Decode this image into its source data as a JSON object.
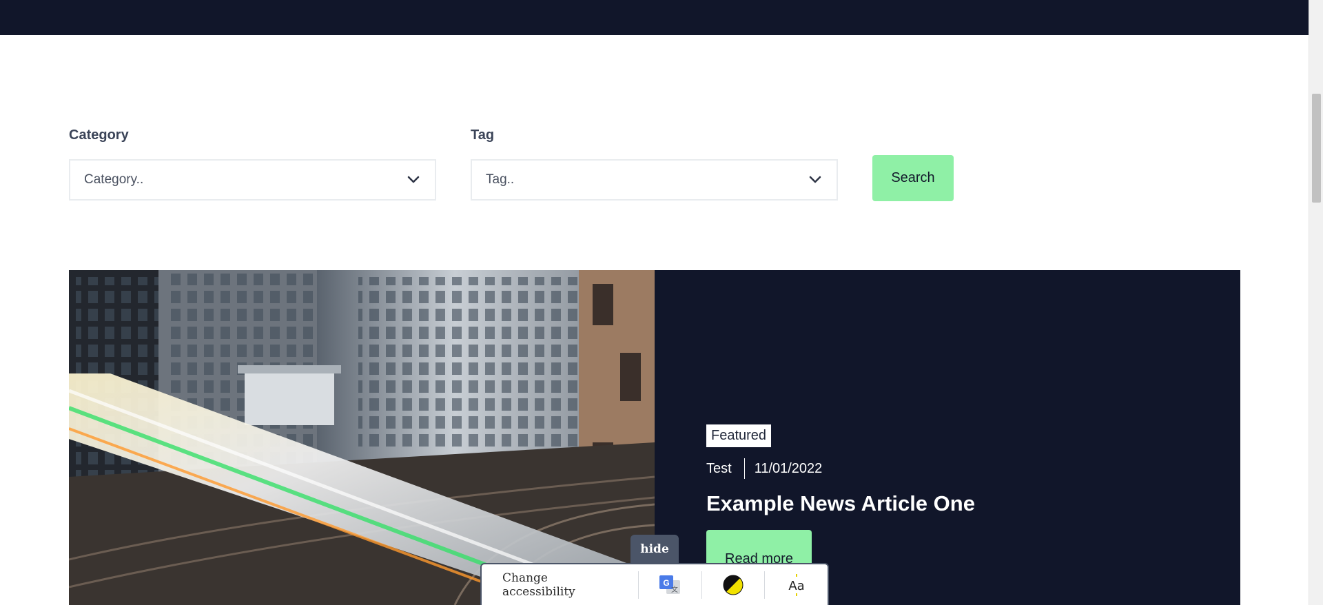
{
  "filters": {
    "category": {
      "label": "Category",
      "placeholder": "Category.."
    },
    "tag": {
      "label": "Tag",
      "placeholder": "Tag.."
    },
    "search_label": "Search"
  },
  "featured_article": {
    "badge": "Featured",
    "category": "Test",
    "date": "11/01/2022",
    "title": "Example News Article One",
    "read_more_label": "Read more",
    "image_icon": "train-city-photo"
  },
  "accessibility_bar": {
    "hide_label": "hide",
    "change_label": "Change accessibility",
    "buttons": [
      "google-translate-icon",
      "contrast-icon",
      "font-size-icon"
    ]
  },
  "colors": {
    "navy": "#11162a",
    "accent_green": "#8ff0a6",
    "label_gray": "#3b4458"
  }
}
